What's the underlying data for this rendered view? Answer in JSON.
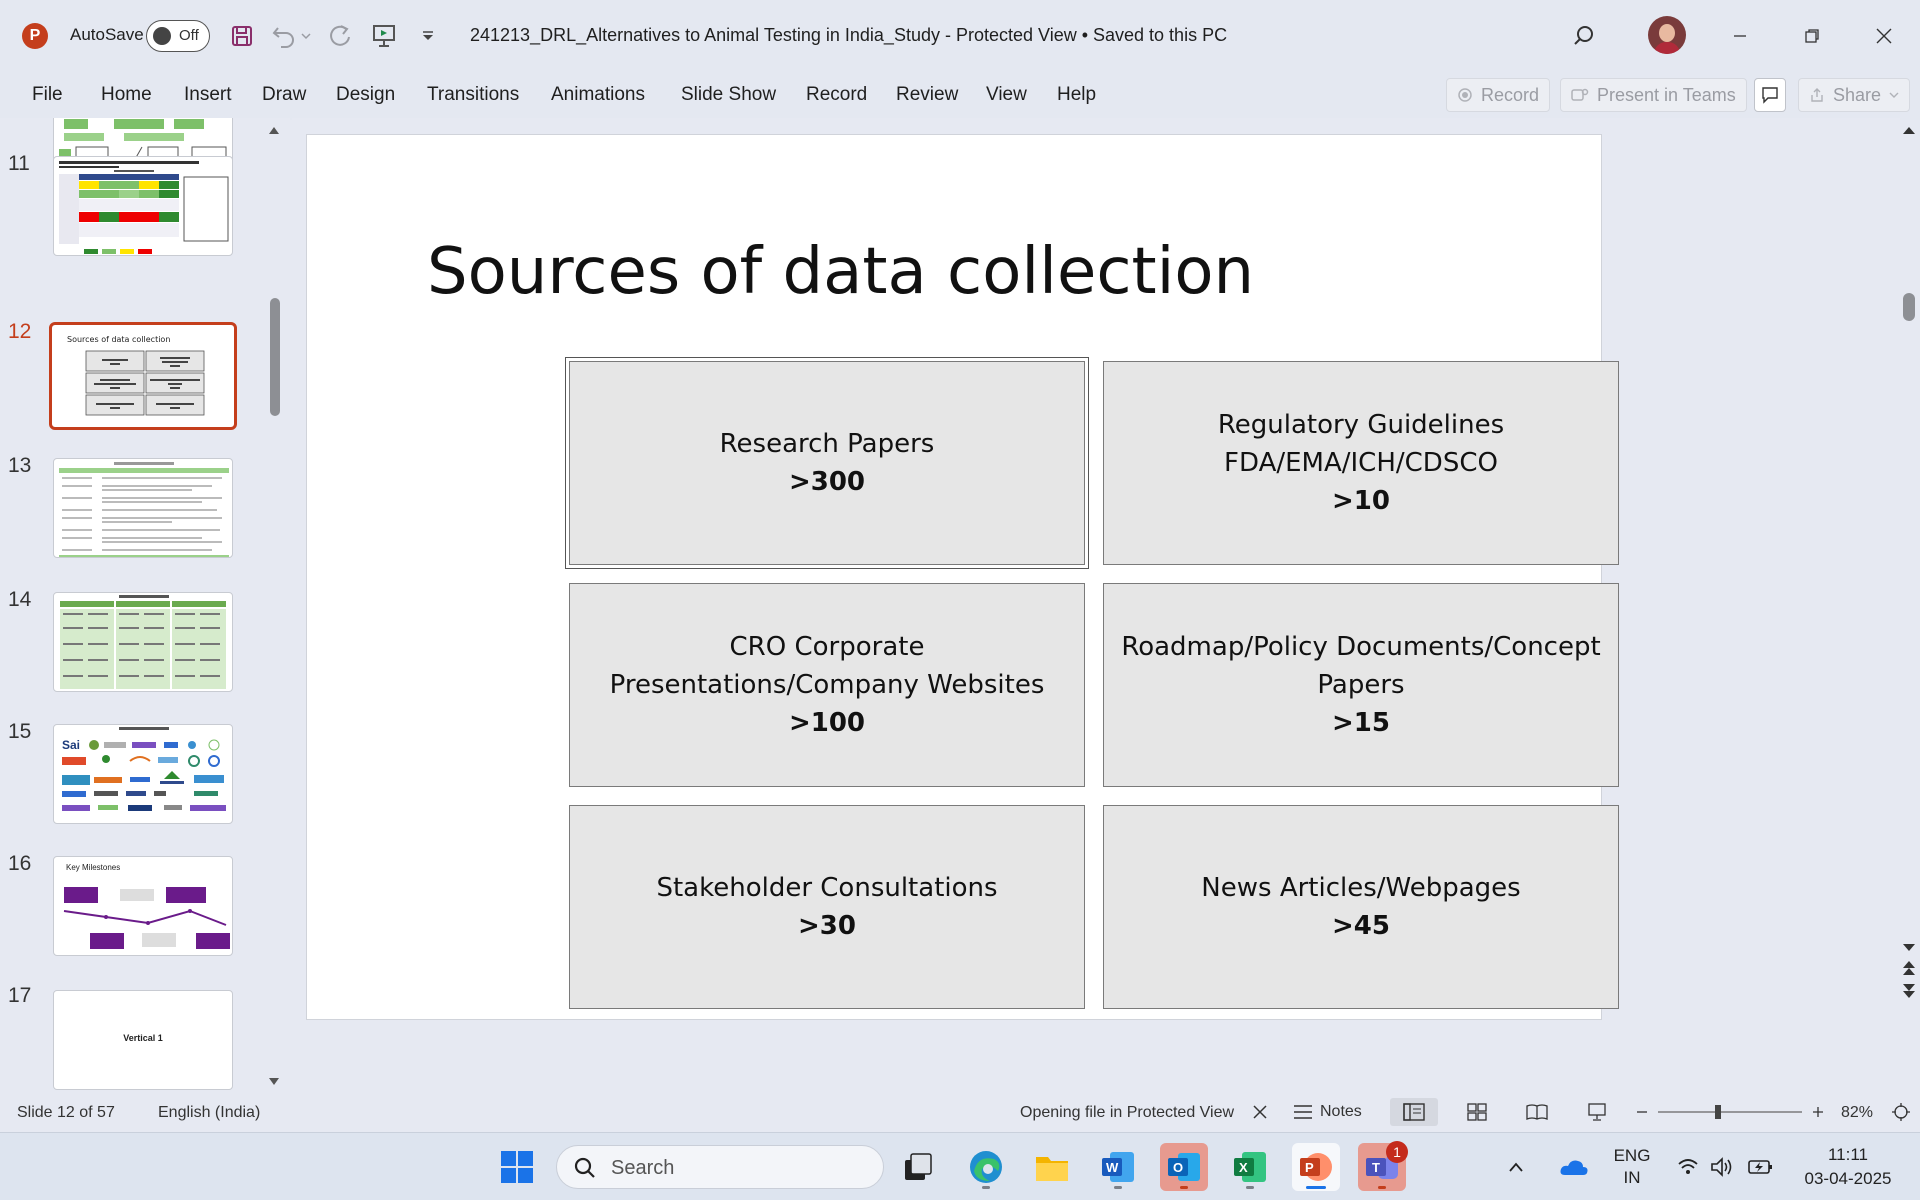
{
  "titlebar": {
    "app_icon_letter": "P",
    "autosave_label": "AutoSave",
    "autosave_state": "Off",
    "document_title": "241213_DRL_Alternatives to Animal Testing in India_Study  -  Protected View • Saved to this PC"
  },
  "ribbon": {
    "tabs": [
      "File",
      "Home",
      "Insert",
      "Draw",
      "Design",
      "Transitions",
      "Animations",
      "Slide Show",
      "Record",
      "Review",
      "View",
      "Help"
    ],
    "record_label": "Record",
    "present_label": "Present in Teams",
    "share_label": "Share"
  },
  "thumbnails": {
    "numbers": [
      "11",
      "12",
      "13",
      "14",
      "15",
      "16",
      "17"
    ],
    "active_number": "12",
    "slide12_title": "Sources of data collection",
    "slide16_title": "Key Milestones",
    "slide17_title": "Vertical 1"
  },
  "slide": {
    "title": "Sources of data collection",
    "boxes": [
      {
        "lines": [
          "Research Papers"
        ],
        "count": ">300"
      },
      {
        "lines": [
          "Regulatory Guidelines",
          "FDA/EMA/ICH/CDSCO"
        ],
        "count": ">10"
      },
      {
        "lines": [
          "CRO Corporate",
          "Presentations/Company Websites"
        ],
        "count": ">100"
      },
      {
        "lines": [
          "Roadmap/Policy Documents/Concept",
          "Papers"
        ],
        "count": ">15"
      },
      {
        "lines": [
          "Stakeholder Consultations"
        ],
        "count": ">30"
      },
      {
        "lines": [
          "News Articles/Webpages"
        ],
        "count": ">45"
      }
    ]
  },
  "statusbar": {
    "slide_indicator": "Slide 12 of 57",
    "language": "English (India)",
    "protected_msg": "Opening file in Protected View",
    "notes_label": "Notes",
    "zoom_level": "82%"
  },
  "taskbar": {
    "search_placeholder": "Search",
    "teams_badge": "1",
    "lang_line1": "ENG",
    "lang_line2": "IN",
    "time": "11:11",
    "date": "03-04-2025"
  },
  "colors": {
    "accent": "#c43e1c",
    "slide_box_fill": "#e6e6e6",
    "chrome_bg": "#e4e8f1"
  }
}
